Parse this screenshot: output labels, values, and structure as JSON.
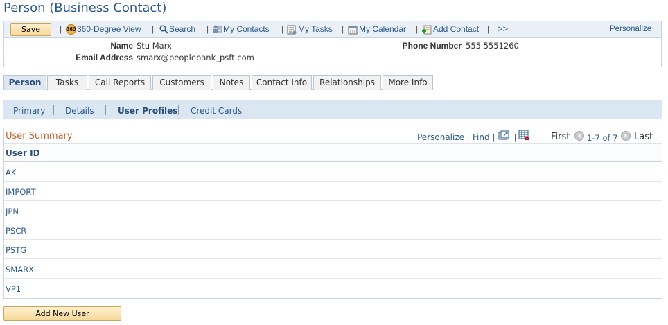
{
  "page": {
    "title": "Person (Business Contact)"
  },
  "toolbar": {
    "save_label": "Save",
    "view360_label": "360-Degree View",
    "view360_badge": "360",
    "search_label": "Search",
    "my_contacts_label": "My Contacts",
    "my_tasks_label": "My Tasks",
    "my_calendar_label": "My Calendar",
    "add_contact_label": "Add Contact",
    "more_label": ">>",
    "personalize_label": "Personalize",
    "separator": "|"
  },
  "header": {
    "name_label": "Name",
    "name_value": "Stu Marx",
    "email_label": "Email Address",
    "email_value": "smarx@peoplebank_psft.com",
    "phone_label": "Phone Number",
    "phone_value": "555 5551260"
  },
  "tabs": [
    {
      "label": "Person",
      "active": true
    },
    {
      "label": "Tasks"
    },
    {
      "label": "Call Reports"
    },
    {
      "label": "Customers"
    },
    {
      "label": "Notes"
    },
    {
      "label": "Contact Info"
    },
    {
      "label": "Relationships"
    },
    {
      "label": "More Info"
    }
  ],
  "subnav": [
    {
      "label": "Primary"
    },
    {
      "label": "Details"
    },
    {
      "label": "User Profiles",
      "active": true
    },
    {
      "label": "Credit Cards"
    }
  ],
  "grid": {
    "title": "User Summary",
    "personalize_label": "Personalize",
    "find_label": "Find",
    "separator": "|",
    "first_label": "First",
    "range_label": "1-7 of 7",
    "last_label": "Last",
    "column_header": "User ID",
    "rows": [
      "AK",
      "IMPORT",
      "JPN",
      "PSCR",
      "PSTG",
      "SMARX",
      "VP1"
    ]
  },
  "actions": {
    "add_new_user_label": "Add New User"
  },
  "colors": {
    "link": "#2b5a8a",
    "title": "#2b5a8a",
    "grid_title": "#c0602a",
    "button_bg": "#f8d899",
    "subnav_bg": "#dae6f2"
  }
}
